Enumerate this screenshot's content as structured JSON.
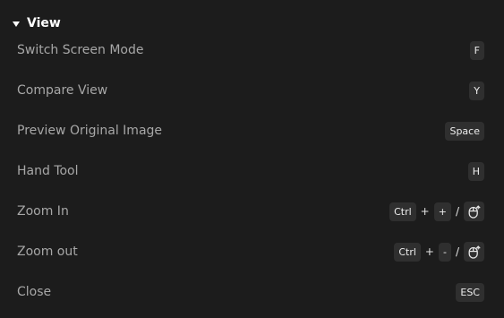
{
  "section": {
    "title": "View"
  },
  "shortcuts": [
    {
      "label": "Switch Screen Mode",
      "keys": [
        "F"
      ]
    },
    {
      "label": "Compare View",
      "keys": [
        "Y"
      ]
    },
    {
      "label": "Preview Original Image",
      "keys": [
        "Space"
      ]
    },
    {
      "label": "Hand Tool",
      "keys": [
        "H"
      ]
    },
    {
      "label": "Zoom In",
      "keys": [
        "Ctrl",
        "+",
        "+"
      ],
      "alt_separator": "/",
      "alt_icon": "mouse-scroll-icon"
    },
    {
      "label": "Zoom out",
      "keys": [
        "Ctrl",
        "+",
        "-"
      ],
      "alt_separator": "/",
      "alt_icon": "mouse-scroll-icon"
    },
    {
      "label": "Close",
      "keys": [
        "ESC"
      ]
    }
  ]
}
